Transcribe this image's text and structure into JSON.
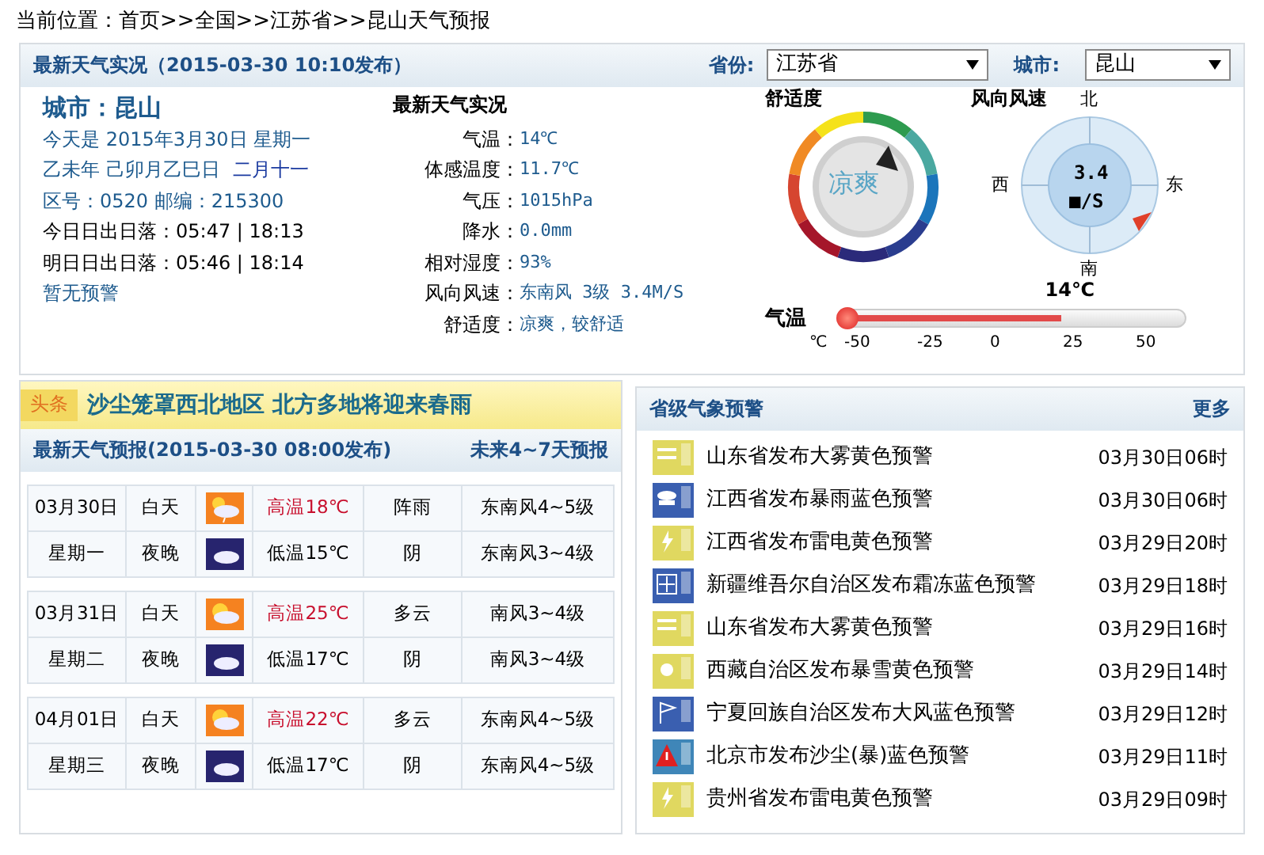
{
  "breadcrumb": "当前位置：首页>>全国>>江苏省>>昆山天气预报",
  "current": {
    "title": "最新天气实况（2015-03-30  10:10发布）",
    "province_label": "省份:",
    "province": "江苏省",
    "city_label": "城市:",
    "city": "昆山",
    "city_name": "城市：昆山",
    "info": [
      {
        "kind": "link",
        "parts": [
          "今天是 2015年3月30日 星期一"
        ]
      },
      {
        "kind": "link",
        "parts": [
          "乙未年 己卯月乙巳日",
          "二月十一"
        ]
      },
      {
        "kind": "link",
        "parts": [
          "区号：0520  邮编：215300"
        ]
      },
      {
        "kind": "plain",
        "parts": [
          "今日日出日落：05:47 | 18:13"
        ]
      },
      {
        "kind": "plain",
        "parts": [
          "明日日出日落：05:46 | 18:14"
        ]
      },
      {
        "kind": "link",
        "parts": [
          "暂无预警"
        ]
      }
    ],
    "obs_title": "最新天气实况",
    "obs": [
      {
        "label": "气温：",
        "value": "14℃"
      },
      {
        "label": "体感温度：",
        "value": "11.7℃"
      },
      {
        "label": "气压：",
        "value": "1015hPa"
      },
      {
        "label": "降水：",
        "value": "0.0mm"
      },
      {
        "label": "相对湿度：",
        "value": "93%"
      },
      {
        "label": "风向风速：",
        "value": "东南风 3级 3.4M/S"
      },
      {
        "label": "舒适度：",
        "value": "凉爽，较舒适"
      }
    ],
    "comfort_title": "舒适度",
    "comfort_value": "凉爽",
    "wind_title": "风向风速",
    "wind_speed": "3.4",
    "wind_unit": "■/S",
    "compass": [
      "北",
      "东",
      "南",
      "西"
    ],
    "temp_title": "气温",
    "temp_reading": "14℃",
    "thermometer": {
      "level": 0.64
    },
    "temp_unit": "℃",
    "temp_ticks": [
      "-50",
      "-25",
      "0",
      "25",
      "50"
    ]
  },
  "headline": {
    "tag": "头条",
    "text": "沙尘笼罩西北地区  北方多地将迎来春雨"
  },
  "forecast": {
    "title": "最新天气预报(2015-03-30  08:00发布)",
    "more": "未来4~7天预报",
    "days": [
      {
        "date": "03月30日",
        "weekday": "星期一",
        "periods": [
          {
            "name": "白天",
            "kind": "shower",
            "temp": "高温18℃",
            "weather": "阵雨",
            "wind": "东南风4~5级"
          },
          {
            "name": "夜晚",
            "kind": "overcast",
            "temp": "低温15℃",
            "weather": "阴",
            "wind": "东南风3~4级"
          }
        ]
      },
      {
        "date": "03月31日",
        "weekday": "星期二",
        "periods": [
          {
            "name": "白天",
            "kind": "partly",
            "temp": "高温25℃",
            "weather": "多云",
            "wind": "南风3~4级"
          },
          {
            "name": "夜晚",
            "kind": "overcast",
            "temp": "低温17℃",
            "weather": "阴",
            "wind": "南风3~4级"
          }
        ]
      },
      {
        "date": "04月01日",
        "weekday": "星期三",
        "periods": [
          {
            "name": "白天",
            "kind": "partly",
            "temp": "高温22℃",
            "weather": "多云",
            "wind": "东南风4~5级"
          },
          {
            "name": "夜晚",
            "kind": "overcast",
            "temp": "低温17℃",
            "weather": "阴",
            "wind": "东南风4~5级"
          }
        ]
      }
    ]
  },
  "warnings": {
    "title": "省级气象预警",
    "more": "更多",
    "items": [
      {
        "kind": "fog",
        "color": "#e0d860",
        "text": "山东省发布大雾黄色预警",
        "time": "03月30日06时"
      },
      {
        "kind": "rain",
        "color": "#3a5fb0",
        "text": "江西省发布暴雨蓝色预警",
        "time": "03月30日06时"
      },
      {
        "kind": "thunder",
        "color": "#e0d860",
        "text": "江西省发布雷电黄色预警",
        "time": "03月29日20时"
      },
      {
        "kind": "frost",
        "color": "#3a5fb0",
        "text": "新疆维吾尔自治区发布霜冻蓝色预警",
        "time": "03月29日18时"
      },
      {
        "kind": "fog",
        "color": "#e0d860",
        "text": "山东省发布大雾黄色预警",
        "time": "03月29日16时"
      },
      {
        "kind": "snow",
        "color": "#e0d860",
        "text": "西藏自治区发布暴雪黄色预警",
        "time": "03月29日14时"
      },
      {
        "kind": "wind",
        "color": "#3a5fb0",
        "text": "宁夏回族自治区发布大风蓝色预警",
        "time": "03月29日12时"
      },
      {
        "kind": "alert",
        "color": "#3f86b8",
        "text": "北京市发布沙尘(暴)蓝色预警",
        "time": "03月29日11时"
      },
      {
        "kind": "thunder",
        "color": "#e0d860",
        "text": "贵州省发布雷电黄色预警",
        "time": "03月29日09时"
      }
    ]
  }
}
